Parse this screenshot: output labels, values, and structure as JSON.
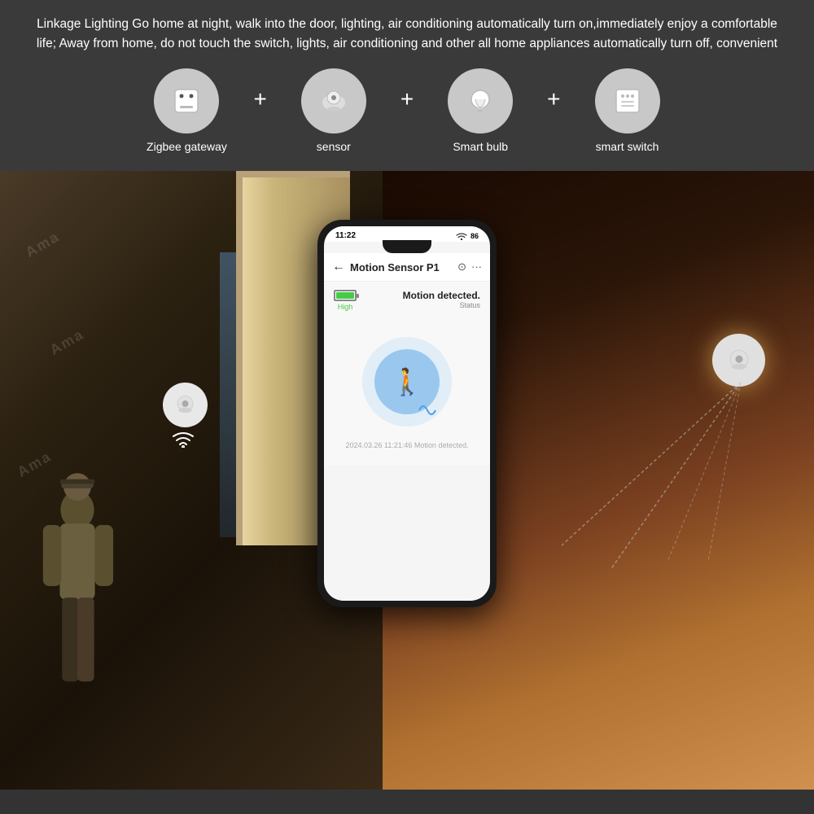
{
  "top": {
    "description": "Linkage Lighting Go home at night, walk into the door, lighting, air conditioning automatically turn on,immediately enjoy a comfortable life; Away from home, do not touch the switch, lights, air conditioning and other all home appliances  automatically turn off, convenient",
    "icons": [
      {
        "id": "zigbee-gateway",
        "label": "Zigbee gateway"
      },
      {
        "id": "sensor",
        "label": "sensor"
      },
      {
        "id": "smart-bulb",
        "label": "Smart bulb"
      },
      {
        "id": "smart-switch",
        "label": "smart switch"
      }
    ]
  },
  "phone": {
    "time": "11:22",
    "signal": "86",
    "title": "Motion Sensor P1",
    "battery_label": "High",
    "motion_status": "Motion detected.",
    "status_sublabel": "Status",
    "timestamp": "2024.03.26  11:21:46  Motion detected."
  },
  "colors": {
    "background_top": "#3a3a3a",
    "text_white": "#ffffff",
    "circle_bg": "#c8c8c8",
    "motion_blue": "#50a0e6",
    "battery_green": "#44cc44"
  }
}
